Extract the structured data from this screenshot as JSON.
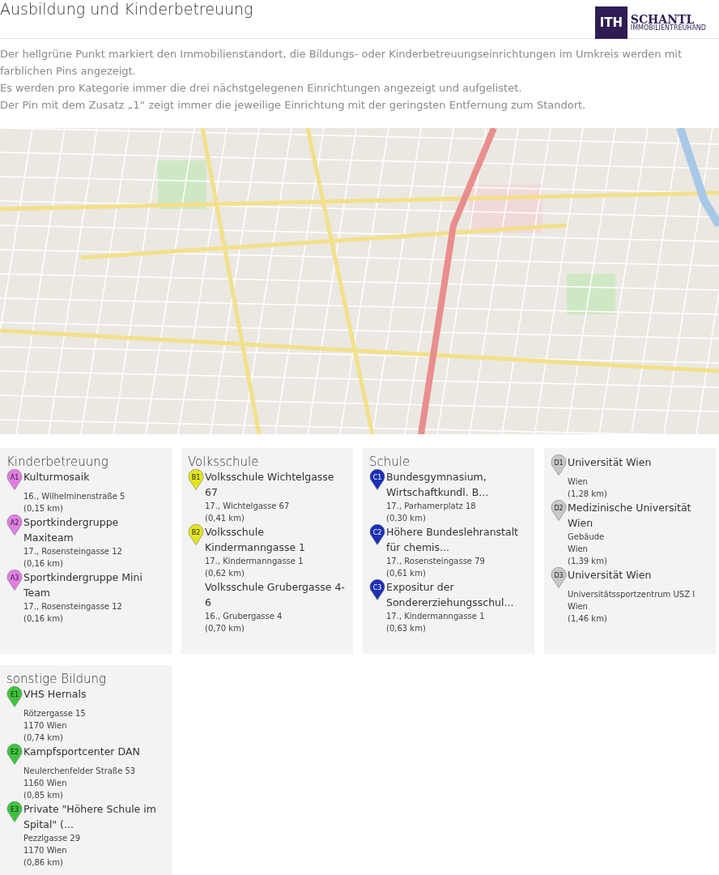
{
  "title": "Ausbildung und Kinderbetreuung",
  "logo": {
    "mark": "ITH",
    "name": "SCHANTL",
    "tagline": "IMMOBILIENTREUHAND"
  },
  "description": [
    "Der hellgrüne Punkt markiert den Immobilienstandort, die Bildungs- oder Kinderbetreuungseinrichtungen im Umkreis werden mit farblichen Pins angezeigt.",
    "Es werden pro Kategorie immer die drei nächstgelegenen Einrichtungen angezeigt und aufgelistet.",
    "Der Pin mit dem Zusatz „1“ zeigt immer die jeweilige Einrichtung mit der geringsten Entfernung zum Standort."
  ],
  "categories": [
    {
      "title": "Kinderbetreuung",
      "color": "#e27de6",
      "items": [
        {
          "pin": "A1",
          "name": "Kulturmosaik",
          "lines": [
            "16., Wilhelminenstraße 5",
            "(0,15 km)"
          ]
        },
        {
          "pin": "A2",
          "name": "Sportkindergruppe Maxiteam",
          "lines": [
            "17., Rosensteingasse 12",
            "(0,16 km)"
          ]
        },
        {
          "pin": "A3",
          "name": "Sportkindergruppe Mini Team",
          "lines": [
            "17., Rosensteingasse 12",
            "(0,16 km)"
          ]
        }
      ]
    },
    {
      "title": "Volksschule",
      "color": "#e4e41c",
      "items": [
        {
          "pin": "B1",
          "name": "Volksschule Wichtelgasse 67",
          "lines": [
            "17., Wichtelgasse 67",
            "(0,41 km)"
          ]
        },
        {
          "pin": "B2",
          "name": "Volksschule Kindermanngasse 1",
          "lines": [
            "17., Kindermanngasse 1",
            "(0,62 km)"
          ]
        },
        {
          "name": "Volksschule Grubergasse 4-6",
          "lines": [
            "16., Grubergasse 4",
            "(0,70 km)"
          ]
        }
      ]
    },
    {
      "title": "Schule",
      "color": "#1c2fb5",
      "items": [
        {
          "pin": "C1",
          "name": "Bundesgymnasium, Wirtschaftkundl. B...",
          "lines": [
            "17., Parhamerplatz 18",
            "(0,30 km)"
          ]
        },
        {
          "pin": "C2",
          "name": "Höhere Bundeslehranstalt für chemis...",
          "lines": [
            "17., Rosensteingasse 79",
            "(0,61 km)"
          ]
        },
        {
          "pin": "C3",
          "name": "Expositur der Sondererziehungsschul...",
          "lines": [
            "17., Kindermanngasse 1",
            "(0,63 km)"
          ]
        }
      ]
    },
    {
      "color": "#c9c9c9",
      "items": [
        {
          "pin": "D1",
          "name": "Universität Wien",
          "lines": [
            "Wien",
            "(1,28 km)"
          ]
        },
        {
          "pin": "D2",
          "name": "Medizinische Universität Wien",
          "lines": [
            "Gebäude",
            "Wien",
            "(1,39 km)"
          ]
        },
        {
          "pin": "D3",
          "name": "Universität Wien",
          "lines": [
            "Universitätssportzentrum USZ I",
            "Wien",
            "(1,46 km)"
          ]
        }
      ]
    },
    {
      "title": "sonstige Bildung",
      "color": "#3cc43c",
      "items": [
        {
          "pin": "E1",
          "name": "VHS Hernals",
          "lines": [
            "Rötzergasse 15",
            "1170 Wien",
            "(0,74 km)"
          ]
        },
        {
          "pin": "E2",
          "name": "Kampfsportcenter DAN",
          "lines": [
            "Neulerchenfelder Straße 53",
            "1160 Wien",
            "(0,85 km)"
          ]
        },
        {
          "pin": "E3",
          "name": "Private \"Höhere Schule im Spital\" (...",
          "lines": [
            "Pezzlgasse 29",
            "1170 Wien",
            "(0,86 km)"
          ]
        }
      ]
    }
  ]
}
